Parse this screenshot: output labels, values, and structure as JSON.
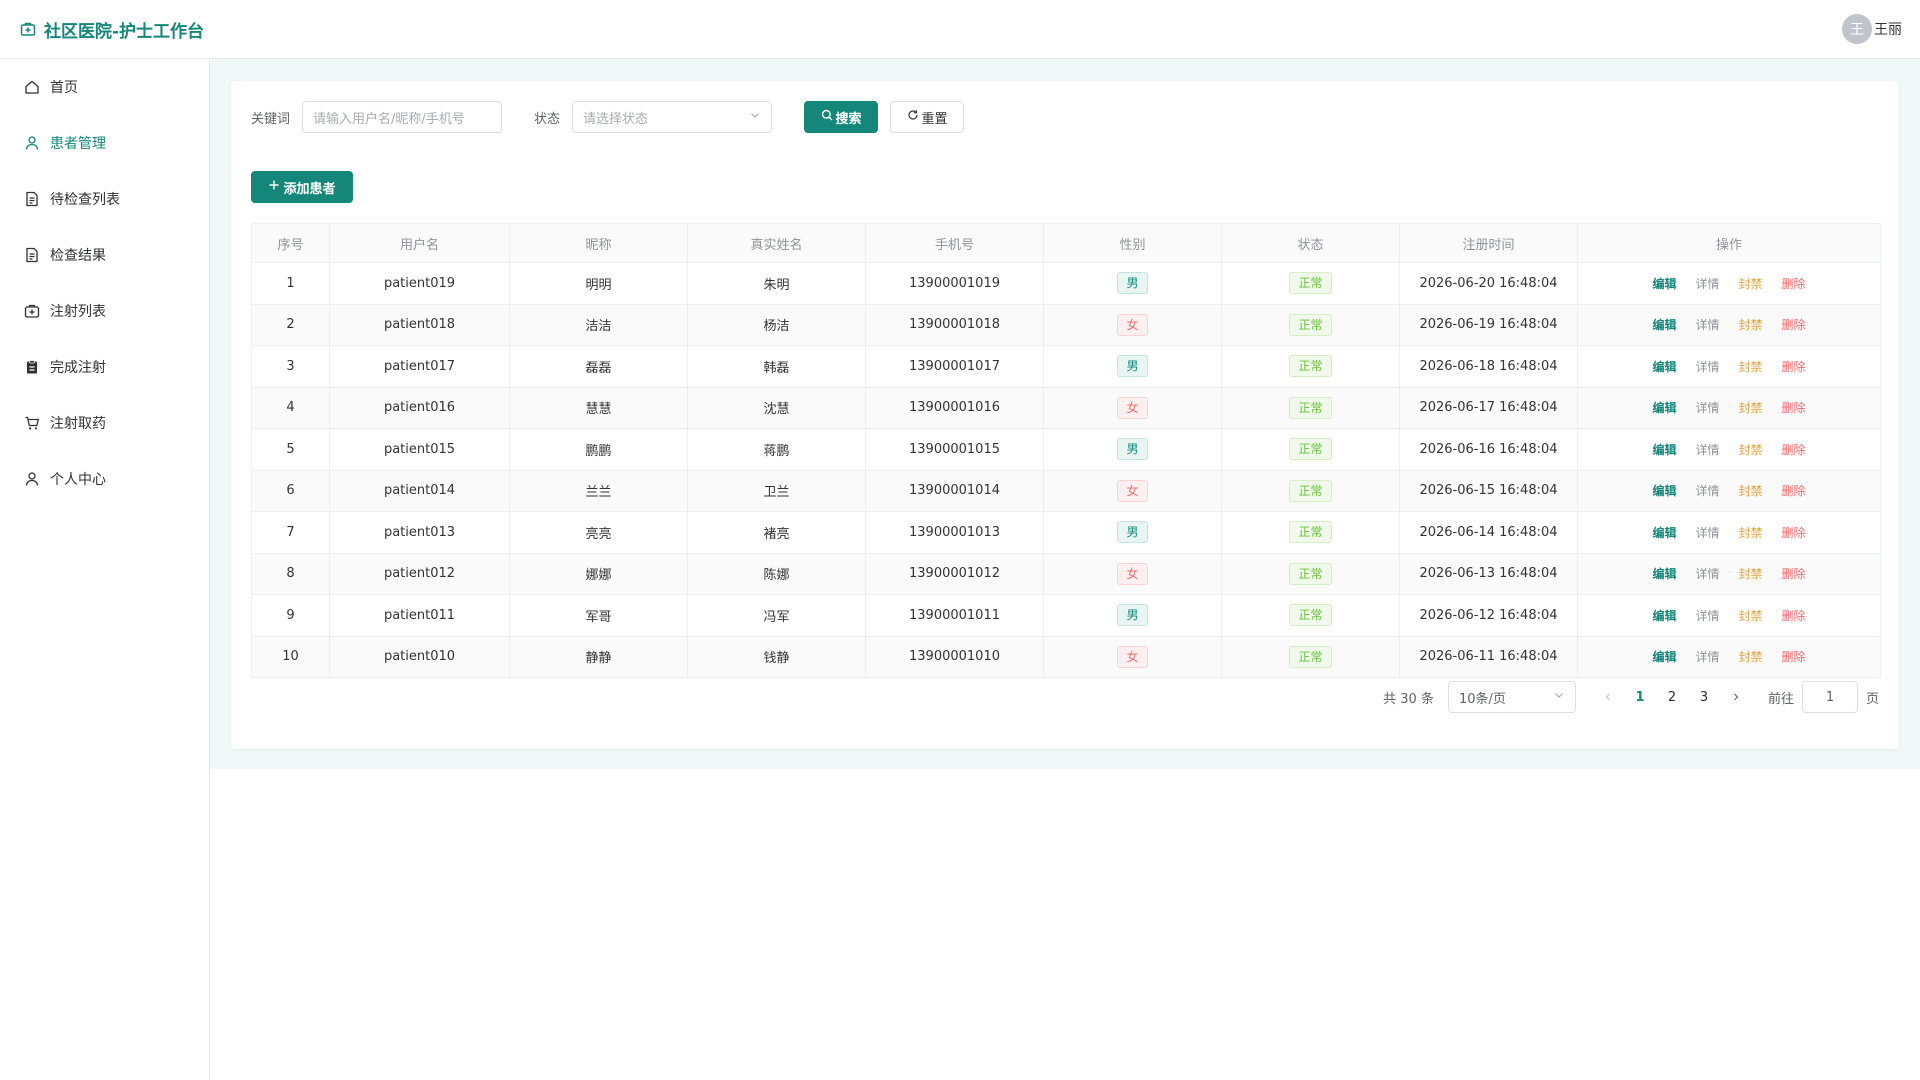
{
  "header": {
    "title": "社区医院-护士工作台",
    "user_avatar": "王",
    "user_name": "王丽"
  },
  "sidebar": {
    "items": [
      {
        "label": "首页",
        "icon": "home-icon"
      },
      {
        "label": "患者管理",
        "icon": "user-icon",
        "active": true
      },
      {
        "label": "待检查列表",
        "icon": "document-icon"
      },
      {
        "label": "检查结果",
        "icon": "document-icon"
      },
      {
        "label": "注射列表",
        "icon": "medical-box-icon"
      },
      {
        "label": "完成注射",
        "icon": "clipboard-icon"
      },
      {
        "label": "注射取药",
        "icon": "cart-icon"
      },
      {
        "label": "个人中心",
        "icon": "user-icon"
      }
    ]
  },
  "search": {
    "keyword_label": "关键词",
    "keyword_placeholder": "请输入用户名/昵称/手机号",
    "status_label": "状态",
    "status_placeholder": "请选择状态",
    "search_button": "搜索",
    "reset_button": "重置"
  },
  "add_button": "添加患者",
  "table": {
    "columns": [
      "序号",
      "用户名",
      "昵称",
      "真实姓名",
      "手机号",
      "性别",
      "状态",
      "注册时间",
      "操作"
    ],
    "actions": [
      "编辑",
      "详情",
      "封禁",
      "删除"
    ],
    "rows": [
      {
        "index": "1",
        "username": "patient019",
        "nickname": "明明",
        "realname": "朱明",
        "phone": "13900001019",
        "gender": "男",
        "status": "正常",
        "registered": "2026-06-20 16:48:04"
      },
      {
        "index": "2",
        "username": "patient018",
        "nickname": "洁洁",
        "realname": "杨洁",
        "phone": "13900001018",
        "gender": "女",
        "status": "正常",
        "registered": "2026-06-19 16:48:04"
      },
      {
        "index": "3",
        "username": "patient017",
        "nickname": "磊磊",
        "realname": "韩磊",
        "phone": "13900001017",
        "gender": "男",
        "status": "正常",
        "registered": "2026-06-18 16:48:04"
      },
      {
        "index": "4",
        "username": "patient016",
        "nickname": "慧慧",
        "realname": "沈慧",
        "phone": "13900001016",
        "gender": "女",
        "status": "正常",
        "registered": "2026-06-17 16:48:04"
      },
      {
        "index": "5",
        "username": "patient015",
        "nickname": "鹏鹏",
        "realname": "蒋鹏",
        "phone": "13900001015",
        "gender": "男",
        "status": "正常",
        "registered": "2026-06-16 16:48:04"
      },
      {
        "index": "6",
        "username": "patient014",
        "nickname": "兰兰",
        "realname": "卫兰",
        "phone": "13900001014",
        "gender": "女",
        "status": "正常",
        "registered": "2026-06-15 16:48:04"
      },
      {
        "index": "7",
        "username": "patient013",
        "nickname": "亮亮",
        "realname": "褚亮",
        "phone": "13900001013",
        "gender": "男",
        "status": "正常",
        "registered": "2026-06-14 16:48:04"
      },
      {
        "index": "8",
        "username": "patient012",
        "nickname": "娜娜",
        "realname": "陈娜",
        "phone": "13900001012",
        "gender": "女",
        "status": "正常",
        "registered": "2026-06-13 16:48:04"
      },
      {
        "index": "9",
        "username": "patient011",
        "nickname": "军哥",
        "realname": "冯军",
        "phone": "13900001011",
        "gender": "男",
        "status": "正常",
        "registered": "2026-06-12 16:48:04"
      },
      {
        "index": "10",
        "username": "patient010",
        "nickname": "静静",
        "realname": "钱静",
        "phone": "13900001010",
        "gender": "女",
        "status": "正常",
        "registered": "2026-06-11 16:48:04"
      }
    ]
  },
  "pagination": {
    "total": "共 30 条",
    "page_size": "10条/页",
    "pages": [
      "1",
      "2",
      "3"
    ],
    "current_page": "1",
    "goto_label": "前往",
    "goto_value": "1",
    "page_suffix": "页"
  },
  "colors": {
    "primary": "#15877a",
    "male": "#15877a",
    "female": "#f56c6c",
    "ok": "#67c23a",
    "ban": "#e6a23c",
    "delete": "#f56c6c"
  }
}
